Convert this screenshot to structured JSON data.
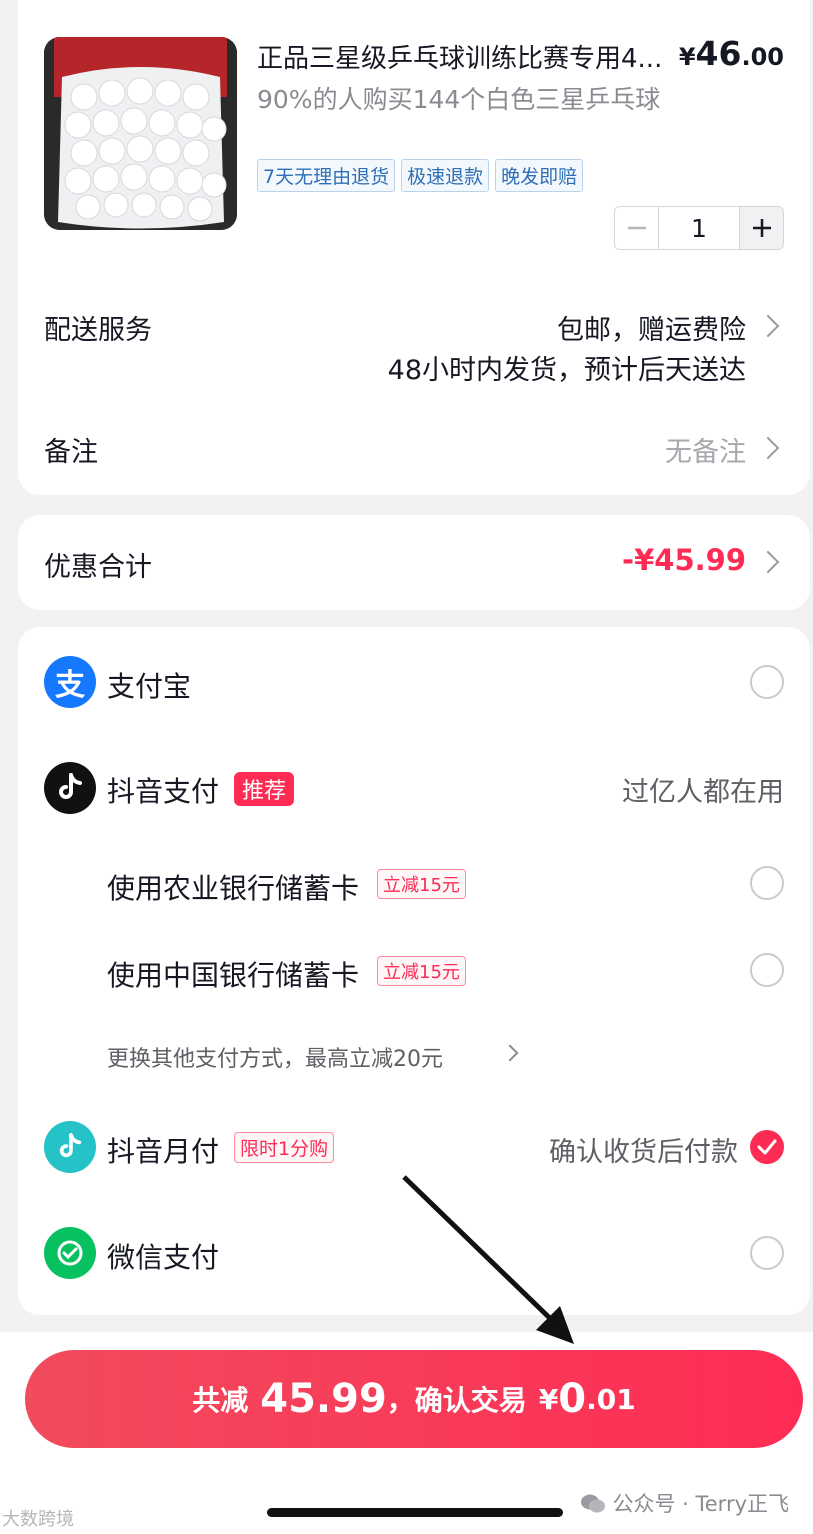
{
  "product": {
    "title": "正品三星级乒乓球训练比赛专用4...",
    "price_symbol": "¥",
    "price_int": "46",
    "price_dec": ".00",
    "subtitle": "90%的人购买144个白色三星乒乓球",
    "tags": [
      "7天无理由退货",
      "极速退款",
      "晚发即赔"
    ],
    "quantity": "1"
  },
  "delivery": {
    "label": "配送服务",
    "line1": "包邮，赠运费险",
    "line2": "48小时内发货，预计后天送达"
  },
  "remark": {
    "label": "备注",
    "value": "无备注"
  },
  "discount": {
    "label": "优惠合计",
    "value": "-¥45.99"
  },
  "payment": {
    "alipay": {
      "label": "支付宝"
    },
    "douyin": {
      "label": "抖音支付",
      "badge": "推荐",
      "note": "过亿人都在用"
    },
    "abc_card": {
      "label": "使用农业银行储蓄卡",
      "badge": "立减15元"
    },
    "boc_card": {
      "label": "使用中国银行储蓄卡",
      "badge": "立减15元"
    },
    "more": {
      "label": "更换其他支付方式，最高立减20元"
    },
    "monthly": {
      "label": "抖音月付",
      "badge": "限时1分购",
      "note": "确认收货后付款",
      "selected": true
    },
    "wechat": {
      "label": "微信支付"
    }
  },
  "confirm": {
    "prefix": "共减",
    "saved": "45.99",
    "middle": "，确认交易",
    "currency": "¥",
    "amount_int": "0",
    "amount_dec": ".01"
  },
  "watermark": {
    "left": "大数跨境",
    "right": "公众号 · Terry正飞"
  },
  "colors": {
    "accent": "#fe2c55",
    "alipay": "#1677ff",
    "wechat": "#07c160",
    "monthly": "#25c2c7"
  }
}
